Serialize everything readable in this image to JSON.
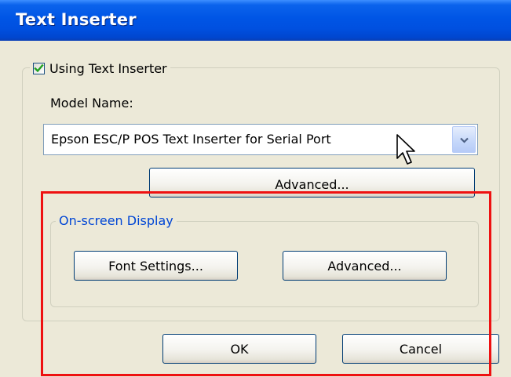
{
  "window": {
    "title": "Text Inserter"
  },
  "using_text_inserter": {
    "label": "Using Text Inserter",
    "checked": true
  },
  "model_name": {
    "label": "Model Name:",
    "selected": "Epson ESC/P POS Text Inserter for Serial Port"
  },
  "advanced_button_label": "Advanced...",
  "on_screen_display": {
    "legend": "On-screen Display",
    "font_settings_label": "Font Settings...",
    "advanced_label": "Advanced..."
  },
  "footer": {
    "ok_label": "OK",
    "cancel_label": "Cancel"
  },
  "icons": {
    "checkbox": "checkmark-icon",
    "dropdown": "chevron-down-icon",
    "cursor": "mouse-pointer-icon"
  },
  "colors": {
    "titlebar": "#0055e5",
    "dialog_background": "#ece9d8",
    "group_legend": "#0046d5",
    "checkmark": "#21a121",
    "highlight": "#ee1111"
  }
}
